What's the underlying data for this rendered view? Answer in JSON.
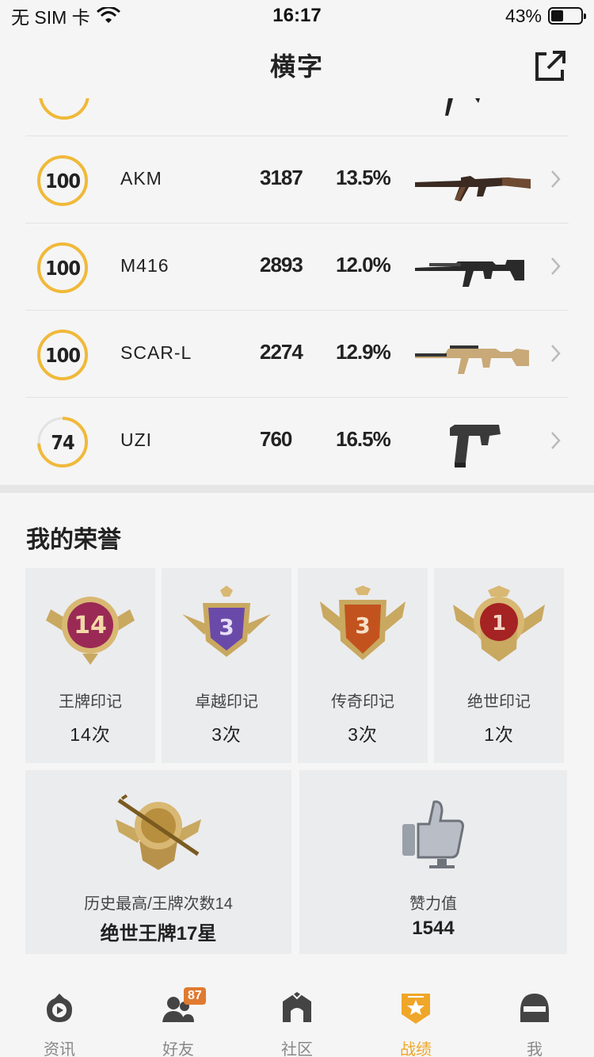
{
  "status_bar": {
    "carrier": "无 SIM 卡",
    "time": "16:17",
    "battery": "43%",
    "battery_level": 0.43
  },
  "header": {
    "title": "横字",
    "share_icon": "share-external-icon"
  },
  "weapons": [
    {
      "rating": "100",
      "progress": 1.0,
      "name": "AKM",
      "kills": "3187",
      "rate": "13.5%"
    },
    {
      "rating": "100",
      "progress": 1.0,
      "name": "M416",
      "kills": "2893",
      "rate": "12.0%"
    },
    {
      "rating": "100",
      "progress": 1.0,
      "name": "SCAR-L",
      "kills": "2274",
      "rate": "12.9%"
    },
    {
      "rating": "74",
      "progress": 0.74,
      "name": "UZI",
      "kills": "760",
      "rate": "16.5%"
    }
  ],
  "honors": {
    "title": "我的荣誉",
    "badges": [
      {
        "number": "14",
        "label": "王牌印记",
        "count": "14次",
        "color": "#9a2a55"
      },
      {
        "number": "3",
        "label": "卓越印记",
        "count": "3次",
        "color": "#6a4aa8"
      },
      {
        "number": "3",
        "label": "传奇印记",
        "count": "3次",
        "color": "#c2531e"
      },
      {
        "number": "1",
        "label": "绝世印记",
        "count": "1次",
        "color": "#a52323"
      }
    ],
    "history": {
      "label": "历史最高/王牌次数14",
      "value": "绝世王牌17星"
    },
    "likes": {
      "label": "赞力值",
      "value": "1544"
    }
  },
  "tabs": [
    {
      "label": "资讯",
      "icon": "news-play-icon",
      "active": false
    },
    {
      "label": "好友",
      "icon": "friends-icon",
      "badge": "87",
      "active": false
    },
    {
      "label": "社区",
      "icon": "community-icon",
      "active": false
    },
    {
      "label": "战绩",
      "icon": "record-shield-icon",
      "active": true
    },
    {
      "label": "我",
      "icon": "helmet-icon",
      "active": false
    }
  ],
  "colors": {
    "accent": "#f0a628",
    "ring": "#f0b93a",
    "background": "#f5f5f5"
  }
}
